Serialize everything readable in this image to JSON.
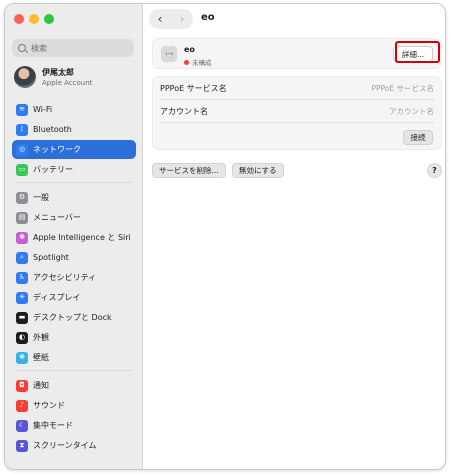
{
  "window": {
    "title": "eo"
  },
  "search": {
    "placeholder": "検索"
  },
  "account": {
    "name": "伊尾太郎",
    "subtitle": "Apple Account"
  },
  "sidebar": {
    "items": [
      {
        "label": "Wi-Fi",
        "icon": "wifi-icon",
        "color": "#2f7bf5",
        "glyph": "≋"
      },
      {
        "label": "Bluetooth",
        "icon": "bluetooth-icon",
        "color": "#2f7bf5",
        "glyph": "ᛒ"
      },
      {
        "label": "ネットワーク",
        "icon": "network-globe-icon",
        "color": "#2f7bf5",
        "glyph": "◎",
        "selected": true
      },
      {
        "label": "バッテリー",
        "icon": "battery-icon",
        "color": "#34c759",
        "glyph": "▭"
      },
      {
        "label": "一般",
        "icon": "gear-icon",
        "color": "#8e8e93",
        "glyph": "⚙"
      },
      {
        "label": "メニューバー",
        "icon": "menu-bar-icon",
        "color": "#8e8e93",
        "glyph": "▤"
      },
      {
        "label": "Apple Intelligence と Siri",
        "icon": "siri-icon",
        "color": "#c45fd6",
        "glyph": "✺"
      },
      {
        "label": "Spotlight",
        "icon": "spotlight-icon",
        "color": "#2f7bf5",
        "glyph": "⌕"
      },
      {
        "label": "アクセシビリティ",
        "icon": "accessibility-icon",
        "color": "#2f7bf5",
        "glyph": "♿"
      },
      {
        "label": "ディスプレイ",
        "icon": "display-icon",
        "color": "#2f7bf5",
        "glyph": "☀"
      },
      {
        "label": "デスクトップと Dock",
        "icon": "desktop-dock-icon",
        "color": "#1d1d1f",
        "glyph": "▬"
      },
      {
        "label": "外観",
        "icon": "appearance-icon",
        "color": "#1d1d1f",
        "glyph": "◐"
      },
      {
        "label": "壁紙",
        "icon": "wallpaper-icon",
        "color": "#36b2e8",
        "glyph": "❋"
      },
      {
        "label": "通知",
        "icon": "notifications-icon",
        "color": "#ff3b30",
        "glyph": "◘"
      },
      {
        "label": "サウンド",
        "icon": "sound-icon",
        "color": "#ff3b30",
        "glyph": "♪"
      },
      {
        "label": "集中モード",
        "icon": "focus-moon-icon",
        "color": "#5856d6",
        "glyph": "☾"
      },
      {
        "label": "スクリーンタイム",
        "icon": "screen-time-icon",
        "color": "#5856d6",
        "glyph": "⧗"
      }
    ]
  },
  "connection": {
    "name": "eo",
    "status": "未構成",
    "detail_button": "詳細...",
    "icon_text": "‹··›"
  },
  "fields": [
    {
      "label": "PPPoE サービス名",
      "placeholder": "PPPoE サービス名"
    },
    {
      "label": "アカウント名",
      "placeholder": "アカウント名"
    }
  ],
  "connect_button": "接続",
  "delete_service_button": "サービスを削除...",
  "disable_button": "無効にする",
  "help_button": "?"
}
